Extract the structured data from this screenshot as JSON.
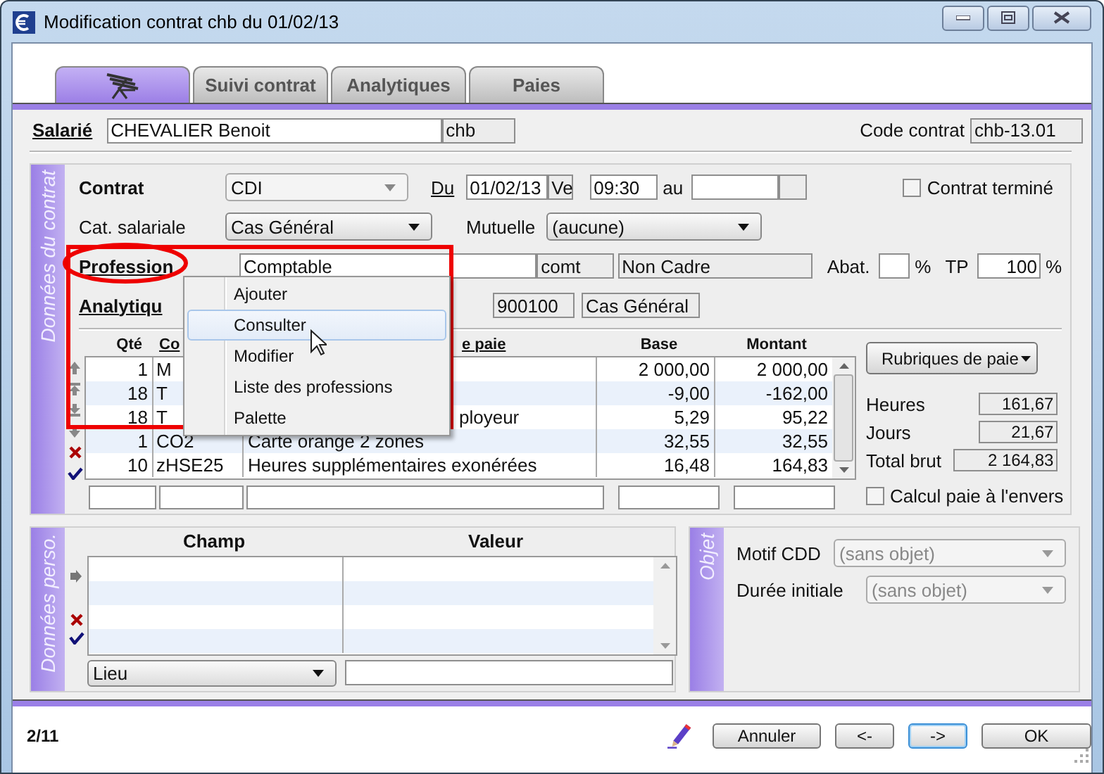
{
  "window": {
    "title": "Modification contrat chb du 01/02/13"
  },
  "tabs": [
    {
      "kind": "icon",
      "selected": true
    },
    {
      "kind": "text",
      "label": "Suivi contrat",
      "selected": false
    },
    {
      "kind": "text",
      "label": "Analytiques",
      "selected": false
    },
    {
      "kind": "text",
      "label": "Paies",
      "selected": false
    }
  ],
  "employee": {
    "label": "Salarié",
    "name": "CHEVALIER Benoit",
    "code": "chb"
  },
  "contract_code": {
    "label": "Code contrat",
    "value": "chb-13.01"
  },
  "contract": {
    "title": "Données du contrat",
    "type": {
      "label": "Contrat",
      "value": "CDI"
    },
    "start": {
      "label": "Du",
      "date": "01/02/13",
      "day": "Ve",
      "time": "09:30"
    },
    "end": {
      "label": "au"
    },
    "terminated": {
      "label": "Contrat terminé",
      "checked": false
    },
    "category": {
      "label": "Cat. salariale",
      "value": "Cas Général"
    },
    "mutual": {
      "label": "Mutuelle",
      "value": "(aucune)"
    },
    "profession": {
      "label": "Profession",
      "value": "Comptable",
      "code": "comt",
      "status": "Non Cadre"
    },
    "abatement": {
      "label": "Abat.",
      "unit": "%"
    },
    "part_time": {
      "label": "TP",
      "value": "100",
      "unit": "%"
    },
    "analytics": {
      "label": "Analytiqu",
      "code": "900100",
      "category": "Cas Général"
    },
    "pay_table": {
      "columns": [
        {
          "label": "Qté",
          "link": false
        },
        {
          "label": "Co",
          "link": true
        },
        {
          "label": "e paie",
          "link": true,
          "clipped": true
        },
        {
          "label": "Base",
          "link": false
        },
        {
          "label": "Montant",
          "link": false
        }
      ],
      "rows": [
        {
          "qty": "1",
          "code": "M",
          "base": "2 000,00",
          "amount": "2 000,00"
        },
        {
          "qty": "18",
          "code": "T",
          "base": "-9,00",
          "amount": "-162,00"
        },
        {
          "qty": "18",
          "code": "T",
          "label": "ployeur",
          "clipped": true,
          "base": "5,29",
          "amount": "95,22"
        },
        {
          "qty": "1",
          "code": "CO2",
          "label": "Carte orange 2 zones",
          "clipped": false,
          "base": "32,55",
          "amount": "32,55"
        },
        {
          "qty": "10",
          "code": "zHSE25",
          "label": "Heures supplémentaires exonérées",
          "clipped": false,
          "base": "16,48",
          "amount": "164,83"
        }
      ]
    },
    "rubriques_button": "Rubriques de paie",
    "totals": [
      {
        "label": "Heures",
        "value": "161,67"
      },
      {
        "label": "Jours",
        "value": "21,67"
      },
      {
        "label": "Total brut",
        "value": "2 164,83"
      }
    ],
    "reverse_calc": {
      "label": "Calcul paie à l'envers",
      "checked": false
    }
  },
  "context_menu": {
    "items": [
      {
        "label": "Ajouter",
        "selected": false
      },
      {
        "label": "Consulter",
        "selected": true
      },
      {
        "label": "Modifier",
        "selected": false
      },
      {
        "label": "Liste des professions",
        "selected": false
      },
      {
        "label": "Palette",
        "selected": false
      }
    ]
  },
  "annotation": {
    "label_circled": true,
    "area_framed": true
  },
  "personal": {
    "title": "Données perso.",
    "columns": [
      "Champ",
      "Valeur"
    ],
    "field_select": "Lieu"
  },
  "object": {
    "title": "Objet",
    "fields": [
      {
        "label": "Motif CDD",
        "value": "(sans objet)",
        "disabled": true
      },
      {
        "label": "Durée initiale",
        "value": "(sans objet)",
        "disabled": true
      }
    ]
  },
  "footer": {
    "record": "2/11",
    "buttons": [
      {
        "label": "Annuler",
        "focused": false
      },
      {
        "label": "<-",
        "focused": false
      },
      {
        "label": "->",
        "focused": true
      },
      {
        "label": "OK",
        "focused": false
      }
    ]
  }
}
